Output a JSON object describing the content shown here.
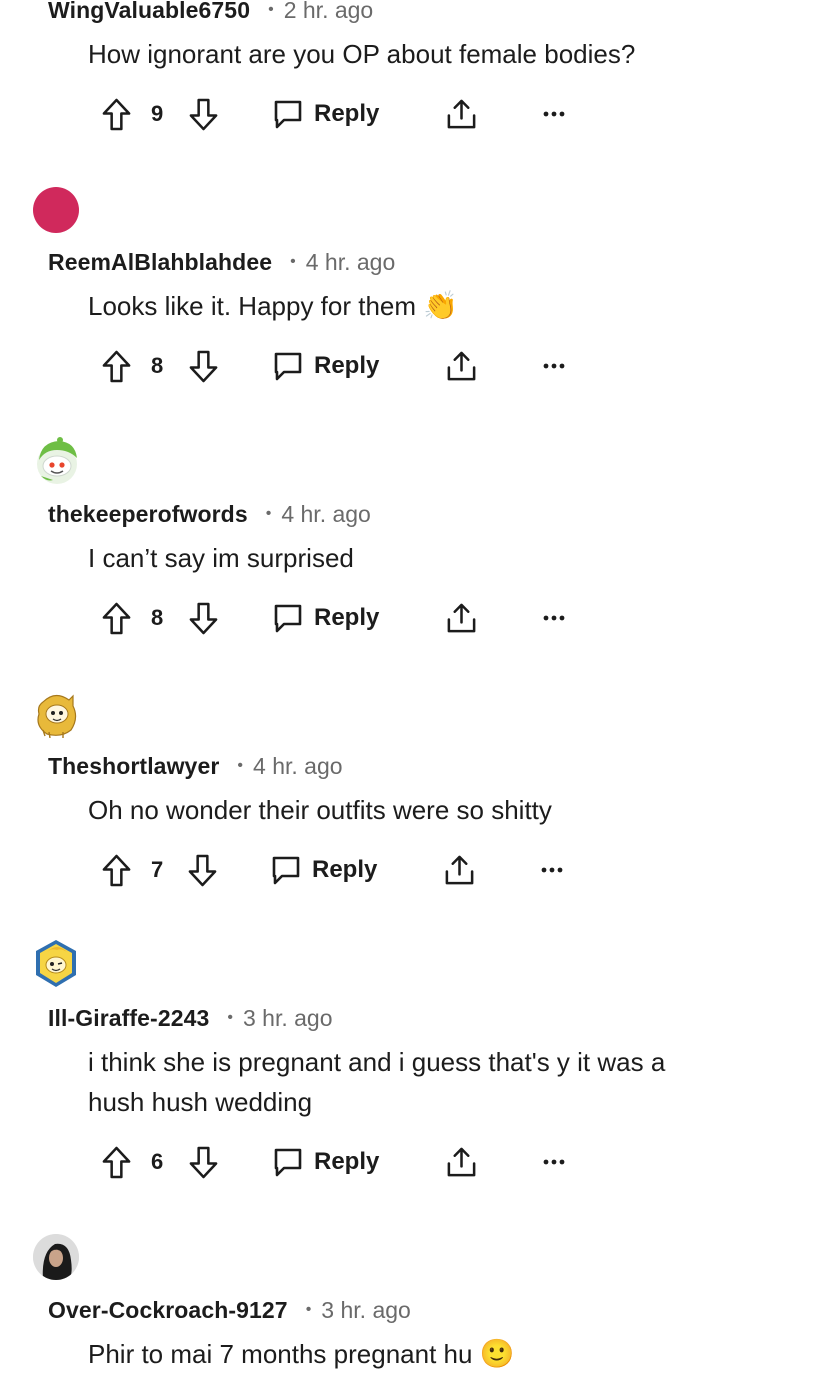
{
  "comments": [
    {
      "username": "WingValuable6750",
      "time": "2 hr. ago",
      "text": "How ignorant are you OP about female bodies?",
      "votes": "9",
      "reply_label": "Reply",
      "avatar": "none"
    },
    {
      "username": "ReemAlBlahblahdee",
      "time": "4 hr. ago",
      "text": "Looks like it. Happy for them",
      "emoji": "👏",
      "votes": "8",
      "reply_label": "Reply",
      "avatar": "pink-circle",
      "avatar_color": "#d0295c"
    },
    {
      "username": "thekeeperofwords",
      "time": "4 hr. ago",
      "text": "I can’t say im surprised",
      "votes": "8",
      "reply_label": "Reply",
      "avatar": "snoo-green-hood"
    },
    {
      "username": "Theshortlawyer",
      "time": "4 hr. ago",
      "text": "Oh no wonder their outfits were so shitty",
      "votes": "7",
      "reply_label": "Reply",
      "avatar": "snoo-yellow-lion"
    },
    {
      "username": "Ill-Giraffe-2243",
      "time": "3 hr. ago",
      "text_lines": [
        "i think she is pregnant and i guess that's y it was a",
        "hush hush wedding"
      ],
      "votes": "6",
      "reply_label": "Reply",
      "avatar": "snoo-banana-hex"
    },
    {
      "username": "Over-Cockroach-9127",
      "time": "3 hr. ago",
      "text": "Phir to mai 7 months pregnant hu",
      "emoji": "🙂",
      "avatar": "photo-dark-hair"
    }
  ],
  "meta_separator": "•",
  "colors": {
    "text": "#1c1c1c",
    "muted": "#6a6a6a",
    "pink": "#d0295c"
  }
}
